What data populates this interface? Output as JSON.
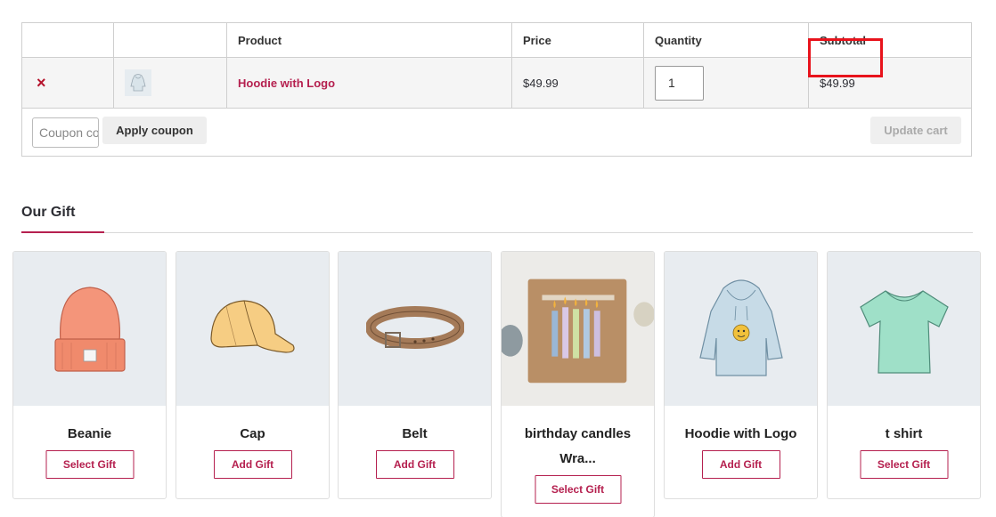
{
  "cart": {
    "headers": {
      "product": "Product",
      "price": "Price",
      "quantity": "Quantity",
      "subtotal": "Subtotal"
    },
    "item": {
      "remove": "×",
      "name": "Hoodie with Logo",
      "price": "$49.99",
      "quantity": "1",
      "subtotal": "$49.99"
    },
    "coupon_placeholder": "Coupon code",
    "apply_label": "Apply coupon",
    "update_label": "Update cart"
  },
  "gifts": {
    "title": "Our Gift",
    "accent_color": "#b5204f",
    "items": [
      {
        "name": "Beanie",
        "button": "Select Gift",
        "icon": "beanie-icon"
      },
      {
        "name": "Cap",
        "button": "Add Gift",
        "icon": "cap-icon"
      },
      {
        "name": "Belt",
        "button": "Add Gift",
        "icon": "belt-icon"
      },
      {
        "name": "birthday candles Wra...",
        "button": "Select Gift",
        "icon": "gift-box-candles-icon"
      },
      {
        "name": "Hoodie with Logo",
        "button": "Add Gift",
        "icon": "hoodie-icon"
      },
      {
        "name": "t shirt",
        "button": "Select Gift",
        "icon": "tshirt-icon"
      }
    ]
  }
}
